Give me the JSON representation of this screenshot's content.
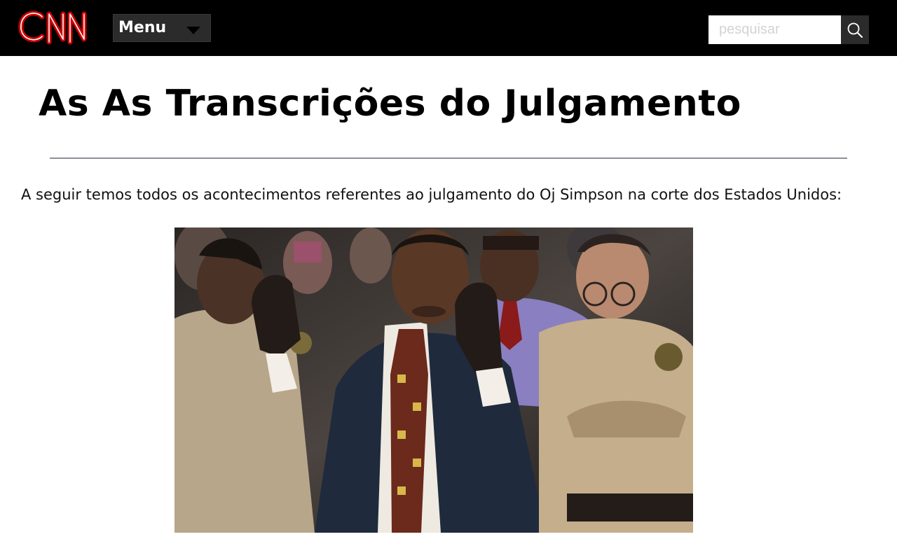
{
  "header": {
    "logo_text": "CNN",
    "menu_label": "Menu",
    "search_placeholder": "pesquisar",
    "search_value": ""
  },
  "main": {
    "title": "As As Transcrições do Julgamento",
    "intro": "A seguir temos todos os acontecimentos referentes ao julgamento do Oj Simpson na corte dos Estados Unidos:"
  },
  "icons": {
    "logo": "cnn-logo",
    "menu": "caret-down-icon",
    "search": "magnifier-icon"
  },
  "colors": {
    "header_bg": "#000000",
    "brand_red": "#cc0000",
    "menu_bg": "#2b2b2b",
    "divider": "#8e8e97"
  }
}
